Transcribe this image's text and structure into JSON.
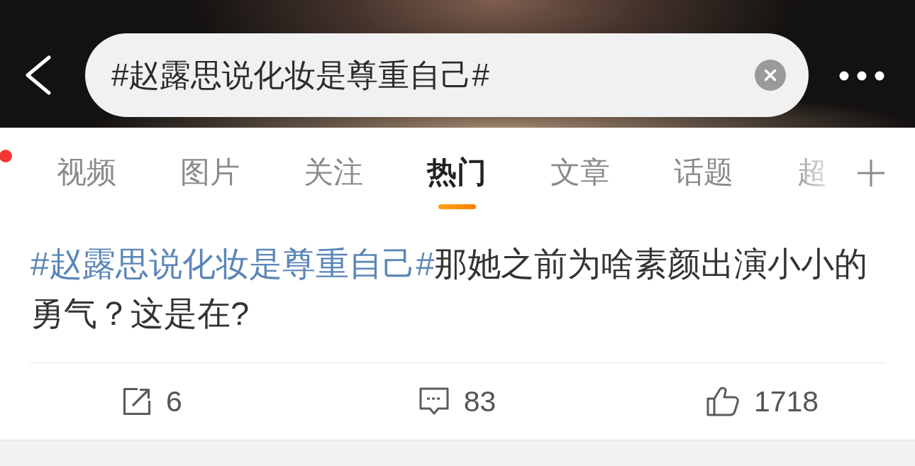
{
  "search_bar": {
    "value": "#赵露思说化妆是尊重自己#"
  },
  "tab_bar": {
    "unread_dot": true,
    "tabs": [
      {
        "label": "视频",
        "selected": false
      },
      {
        "label": "图片",
        "selected": false
      },
      {
        "label": "关注",
        "selected": false
      },
      {
        "label": "热门",
        "selected": true
      },
      {
        "label": "文章",
        "selected": false
      },
      {
        "label": "话题",
        "selected": false
      },
      {
        "label": "超",
        "selected": false
      }
    ]
  },
  "post": {
    "hashtag": "#赵露思说化妆是尊重自己#",
    "text": "那她之前为啥素颜出演小小的勇气？这是在?"
  },
  "actions": [
    {
      "kind": "repost",
      "count": "6"
    },
    {
      "kind": "comment",
      "count": "83"
    },
    {
      "kind": "like",
      "count": "1718"
    }
  ]
}
